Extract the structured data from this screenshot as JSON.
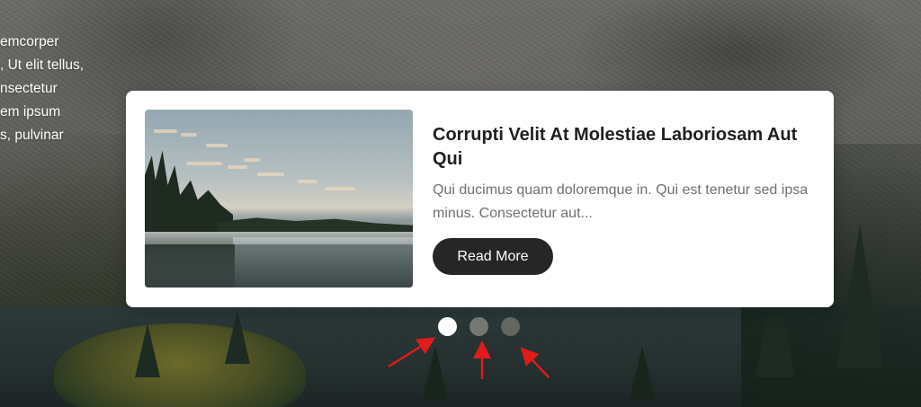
{
  "background": {
    "description_side_text": "emcorper\n, Ut elit tellus,\nnsectetur\nem ipsum\ns, pulvinar"
  },
  "card": {
    "title": "Corrupti Velit At Molestiae Laboriosam Aut Qui",
    "excerpt": "Qui ducimus quam doloremque in. Qui est tenetur sed ipsa minus. Consectetur aut...",
    "read_more_label": "Read More"
  },
  "pagination": {
    "count": 3,
    "active_index": 0
  },
  "annotations": {
    "arrow_color": "#e01b1b"
  },
  "colors": {
    "card_bg": "#ffffff",
    "button_bg": "#262626",
    "title_color": "#1f1f1f",
    "excerpt_color": "#6f6f6f"
  }
}
